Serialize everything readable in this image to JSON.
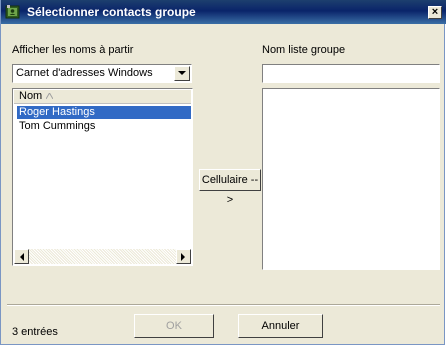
{
  "window": {
    "title": "Sélectionner contacts groupe",
    "close_symbol": "×",
    "icon": "address-book-icon"
  },
  "left": {
    "source_label": "Afficher les noms à partir",
    "source_selected": "Carnet d'adresses Windows",
    "list_header": "Nom",
    "contacts": [
      {
        "name": "Roger Hastings",
        "selected": true
      },
      {
        "name": "Tom Cummings",
        "selected": false
      }
    ]
  },
  "middle": {
    "add_button": "Cellulaire -->"
  },
  "right": {
    "group_label": "Nom liste groupe",
    "group_name_value": ""
  },
  "footer": {
    "status": "3 entrées",
    "ok": "OK",
    "cancel": "Annuler"
  },
  "colors": {
    "selection": "#316ac5",
    "titlebar": "#0a246a",
    "dialog_bg": "#ece9d8"
  }
}
